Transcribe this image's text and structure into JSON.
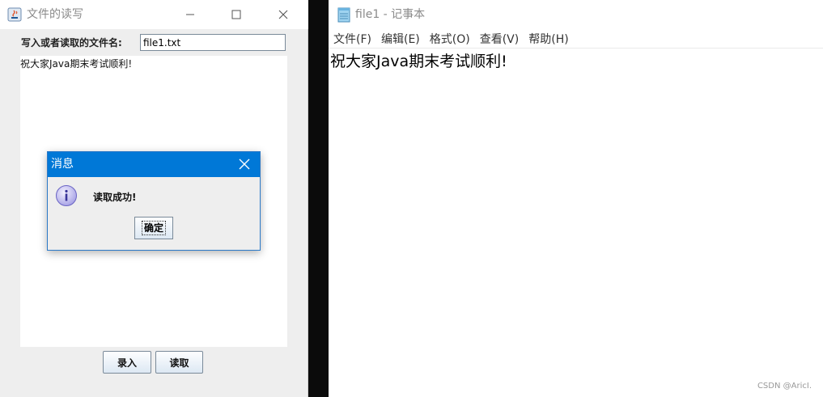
{
  "java_window": {
    "title": "文件的读写",
    "filename_label": "写入或者读取的文件名:",
    "filename_value": "file1.txt",
    "text_content": "祝大家Java期末考试顺利!",
    "buttons": {
      "save": "录入",
      "read": "读取"
    }
  },
  "dialog": {
    "title": "消息",
    "message": "读取成功!",
    "ok_label": "确定",
    "icon": "info-icon"
  },
  "notepad": {
    "title": "file1 - 记事本",
    "menu": [
      "文件(F)",
      "编辑(E)",
      "格式(O)",
      "查看(V)",
      "帮助(H)"
    ],
    "content": "祝大家Java期末考试顺利!"
  },
  "watermark": "CSDN @AricI.",
  "colors": {
    "dialog_title_bg": "#0078d7",
    "divider": "#0b0b0b"
  }
}
